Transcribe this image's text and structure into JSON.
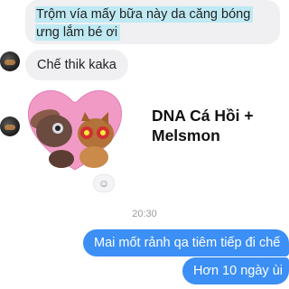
{
  "messages": {
    "received_1": {
      "line1": "Trộm vía mấy bữa này da căng bóng",
      "line2": "ưng lắm bé ơi"
    },
    "received_2": {
      "text": "Chế thik kaka"
    },
    "sticker": {
      "caption": "DNA Cá Hồi + Melsmon",
      "icon": "kissing-cats-heart-sticker"
    },
    "timestamp": "20:30",
    "sent_1": {
      "text": "Mai mốt rảnh qa tiêm tiếp đi chế"
    },
    "sent_2": {
      "text": "Hơn 10 ngày ùi"
    }
  },
  "colors": {
    "sent_bubble": "#3b8ff5",
    "received_bubble": "#f0f0f2",
    "highlight": "#bfe9f3",
    "heart": "#f19ac6"
  },
  "icons": {
    "react": "emoji-plus-icon",
    "avatar": "contact-avatar"
  }
}
